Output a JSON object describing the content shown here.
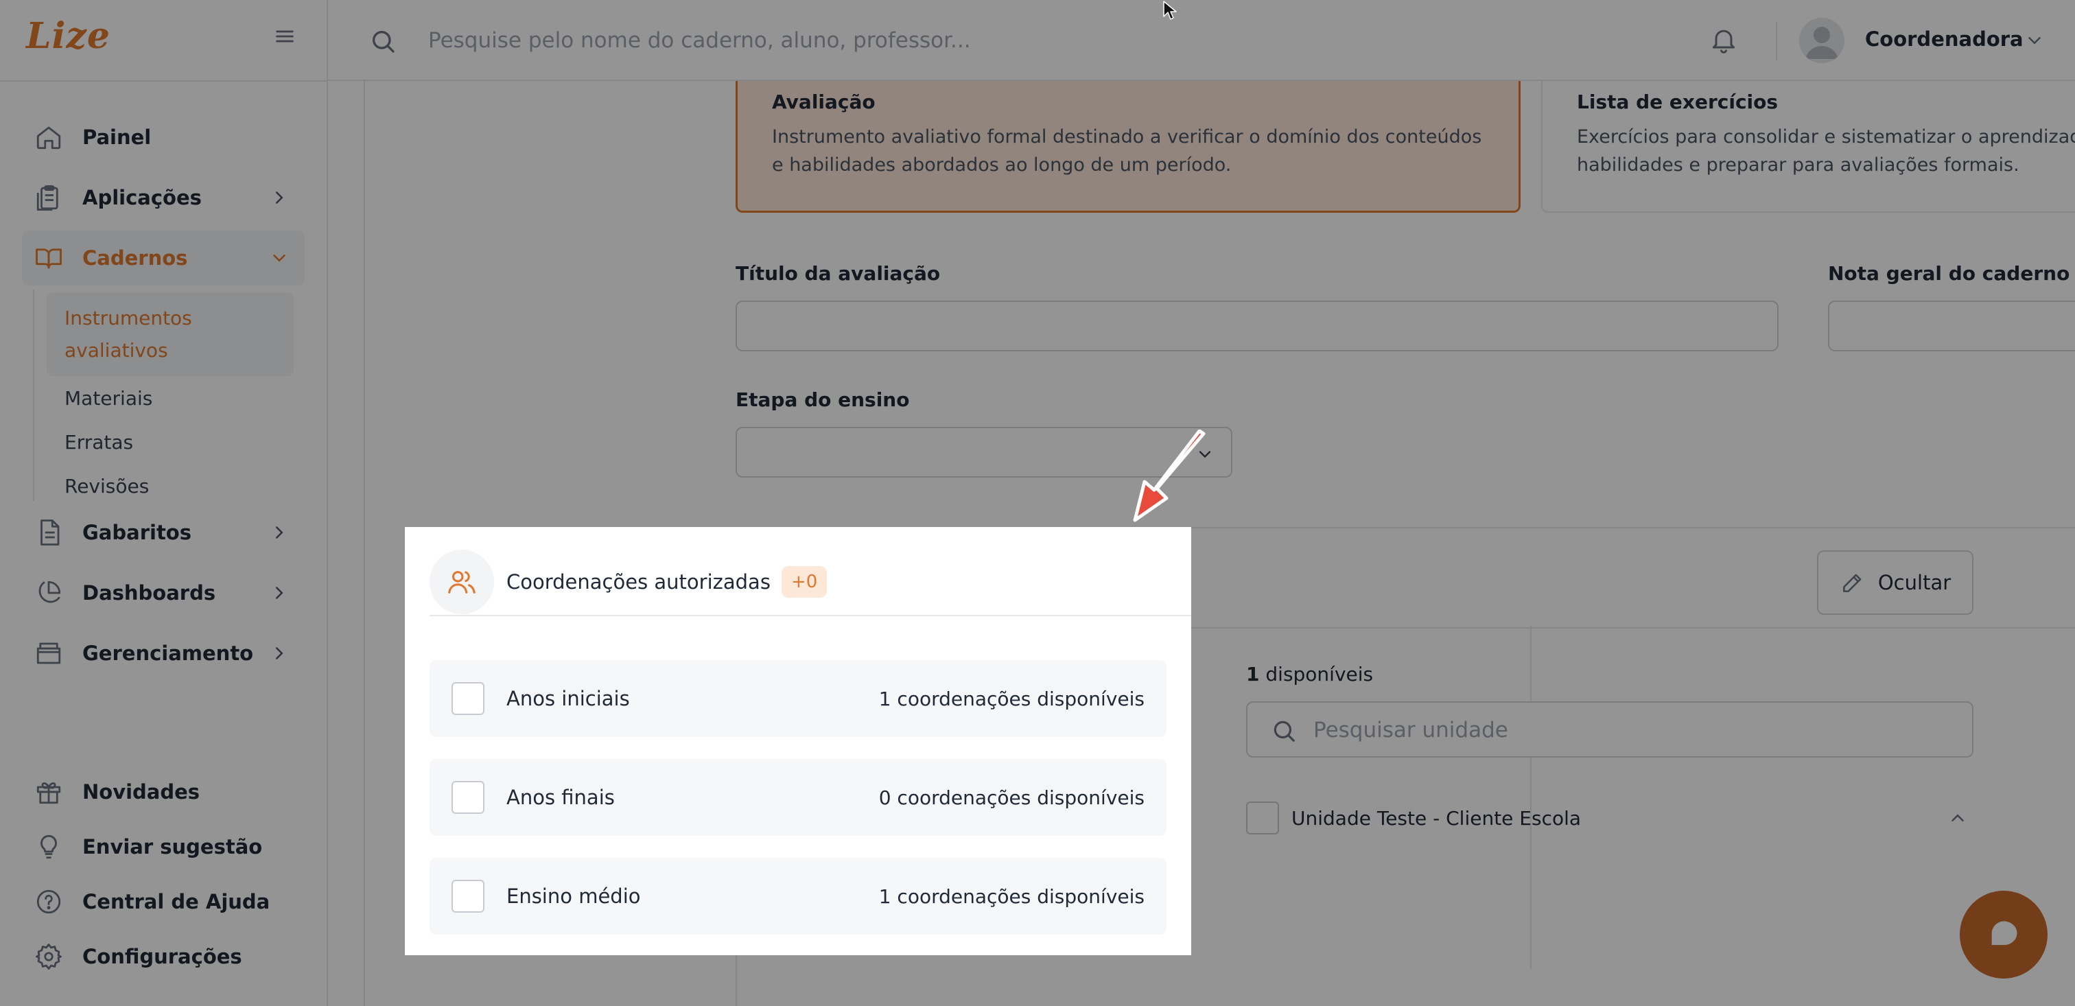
{
  "brand": {
    "logo_text": "Lize",
    "accent_color": "#e0792f"
  },
  "sidebar": {
    "items": [
      {
        "label": "Painel",
        "icon": "home-icon",
        "has_children": false
      },
      {
        "label": "Aplicações",
        "icon": "clipboard-icon",
        "has_children": true
      },
      {
        "label": "Cadernos",
        "icon": "book-icon",
        "has_children": true,
        "expanded": true
      },
      {
        "label": "Gabaritos",
        "icon": "document-icon",
        "has_children": true
      },
      {
        "label": "Dashboards",
        "icon": "pie-chart-icon",
        "has_children": true
      },
      {
        "label": "Gerenciamento",
        "icon": "archive-icon",
        "has_children": true
      }
    ],
    "cadernos_sub": [
      {
        "label": "Instrumentos avaliativos",
        "active": true
      },
      {
        "label": "Materiais"
      },
      {
        "label": "Erratas"
      },
      {
        "label": "Revisões"
      }
    ],
    "bottom": [
      {
        "label": "Novidades",
        "icon": "gift-icon"
      },
      {
        "label": "Enviar sugestão",
        "icon": "lightbulb-icon"
      },
      {
        "label": "Central de Ajuda",
        "icon": "help-circle-icon"
      },
      {
        "label": "Configurações",
        "icon": "gear-icon"
      }
    ]
  },
  "topbar": {
    "search_placeholder": "Pesquise pelo nome do caderno, aluno, professor...",
    "user_name": "Coordenadora"
  },
  "main": {
    "types": [
      {
        "title": "Avaliação",
        "description": "Instrumento avaliativo formal destinado a verificar o domínio dos conteúdos e habilidades abordados ao longo de um período.",
        "selected": true
      },
      {
        "title": "Lista de exercícios",
        "description": "Exercícios para consolidar e sistematizar o aprendizado, desenvolver habilidades e preparar para avaliações formais.",
        "selected": false
      }
    ],
    "title_label": "Título da avaliação",
    "title_value": "",
    "grade_label": "Nota geral do caderno",
    "grade_value": "",
    "stage_label": "Etapa do ensino",
    "stage_value": "",
    "hide_button": "Ocultar",
    "available_count": "1",
    "available_suffix": "disponíveis",
    "unit_search_placeholder": "Pesquisar unidade",
    "units": [
      {
        "label": "Unidade Teste - Cliente Escola"
      }
    ]
  },
  "coordinations": {
    "title": "Coordenações autorizadas",
    "badge": "+0",
    "rows": [
      {
        "label": "Anos iniciais",
        "count": "1 coordenações disponíveis",
        "checked": false
      },
      {
        "label": "Anos finais",
        "count": "0 coordenações disponíveis",
        "checked": false
      },
      {
        "label": "Ensino médio",
        "count": "1 coordenações disponíveis",
        "checked": false
      }
    ]
  }
}
